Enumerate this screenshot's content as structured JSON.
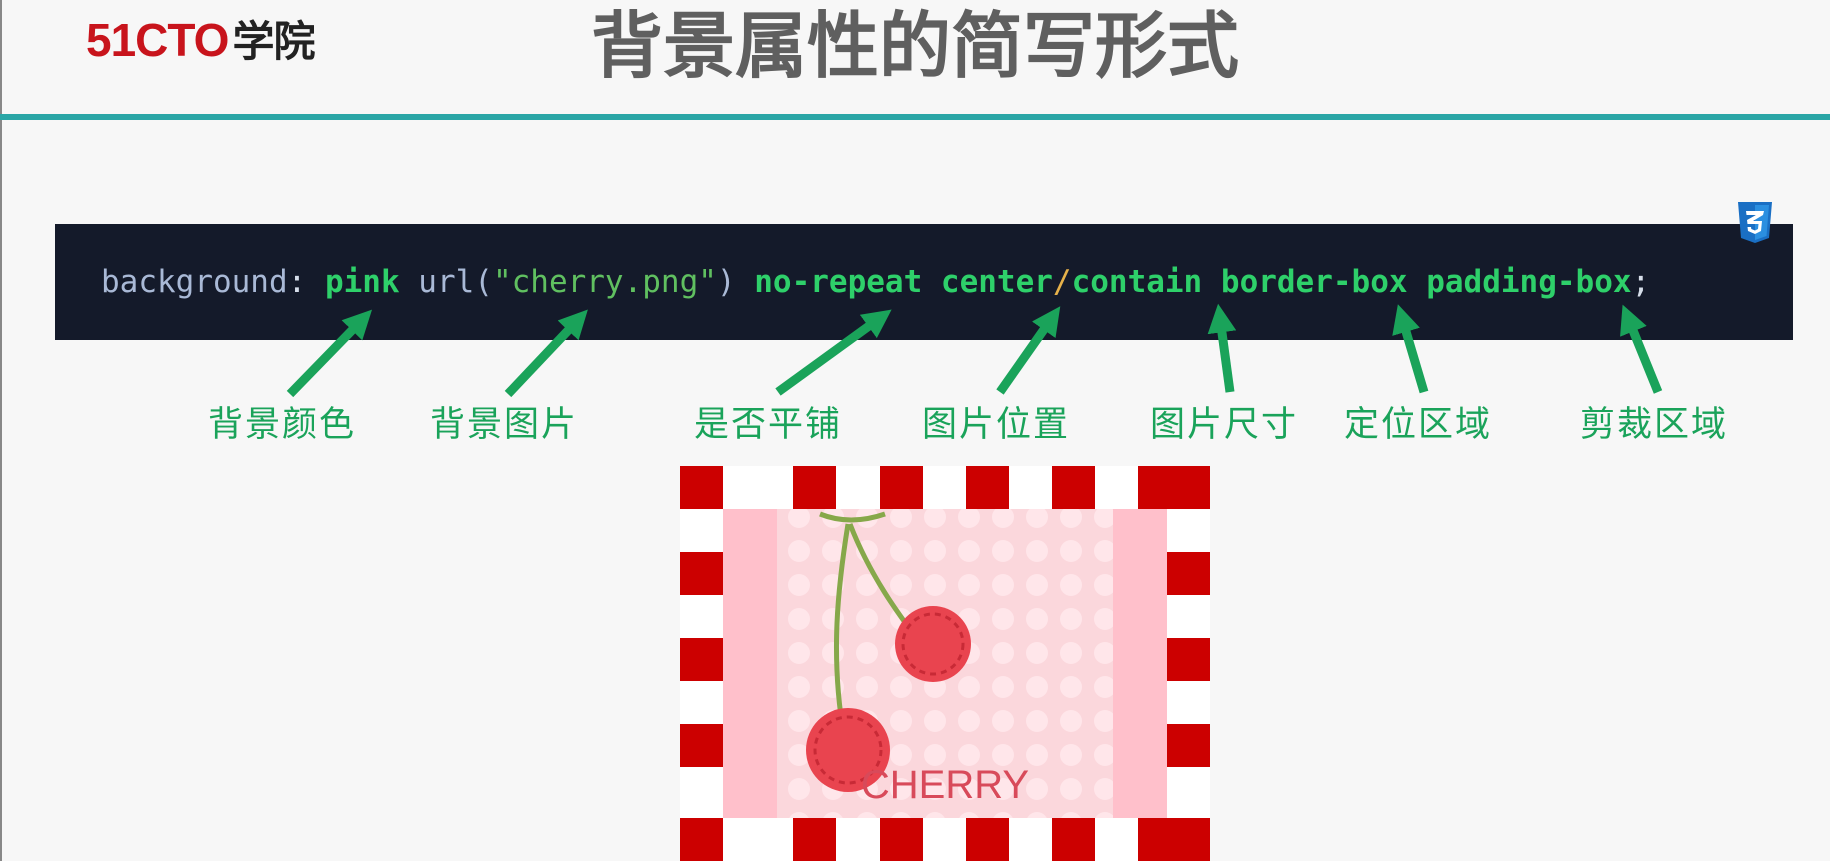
{
  "logo": {
    "brand": "51CTO",
    "suffix": "学院"
  },
  "slide": {
    "title": "背景属性的简写形式"
  },
  "code": {
    "property": "background",
    "colon": ": ",
    "color": "pink",
    "url_fn": "url(",
    "url_str": "\"cherry.png\"",
    "url_close": ")",
    "repeat": "no-repeat",
    "position": "center",
    "slash": "/",
    "size": "contain",
    "origin": "border-box",
    "clip": "padding-box",
    "semi": ";"
  },
  "annotations": {
    "bg_color": "背景颜色",
    "bg_image": "背景图片",
    "repeat": "是否平铺",
    "position": "图片位置",
    "size": "图片尺寸",
    "origin": "定位区域",
    "clip": "剪裁区域"
  },
  "demo": {
    "label": "CHERRY"
  },
  "colors": {
    "teal_rule": "#2aa6a6",
    "code_bg": "#141a2a",
    "annotation_green": "#1aa35a",
    "stripe_red": "#cc0000",
    "pink": "#ffc0cb"
  }
}
